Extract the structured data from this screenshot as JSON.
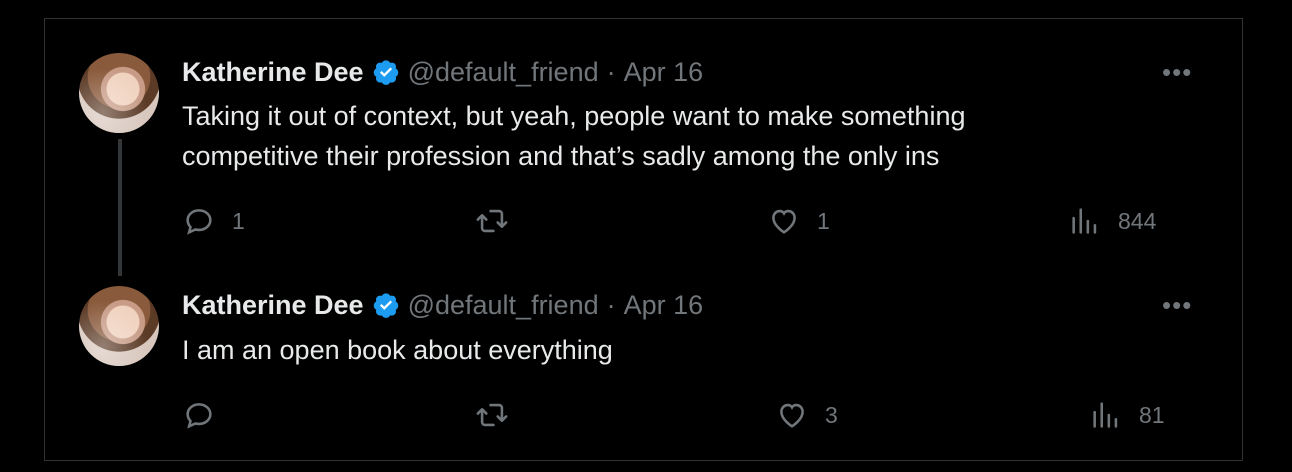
{
  "tweets": [
    {
      "author": "Katherine Dee",
      "handle": "@default_friend",
      "separator": "·",
      "date": "Apr 16",
      "text_lines": [
        "Taking it out of context, but yeah, people want to make something",
        "competitive their profession and that’s sadly among the only ins"
      ],
      "replies": "1",
      "retweets": "",
      "likes": "1",
      "views": "844"
    },
    {
      "author": "Katherine Dee",
      "handle": "@default_friend",
      "separator": "·",
      "date": "Apr 16",
      "text_lines": [
        "I am an open book about everything"
      ],
      "replies": "",
      "retweets": "",
      "likes": "3",
      "views": "81"
    }
  ],
  "more_glyph": "•••",
  "colors": {
    "verified": "#1d9bf0",
    "muted": "#71767b",
    "text": "#e7e9ea",
    "border": "#2f3336"
  }
}
